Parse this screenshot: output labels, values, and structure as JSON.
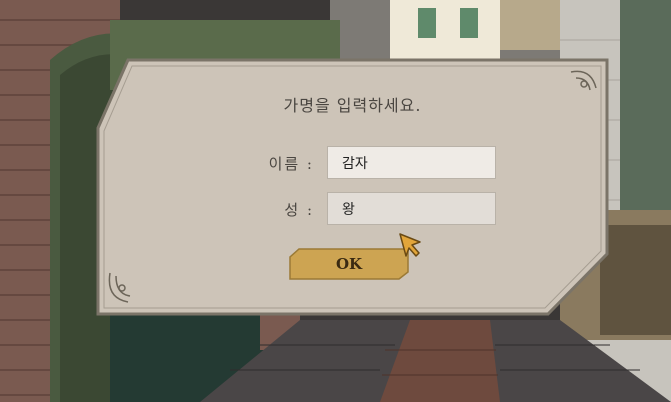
{
  "dialog": {
    "prompt": "가명을 입력하세요.",
    "first_name_label": "이름 :",
    "first_name_value": "감자",
    "last_name_label": "성 :",
    "last_name_value": "왕",
    "ok_label": "OK"
  },
  "colors": {
    "panel": "#cdc4b8",
    "panel_border": "#7b7468",
    "button": "#cda452",
    "cursor": "#e2a53a"
  }
}
